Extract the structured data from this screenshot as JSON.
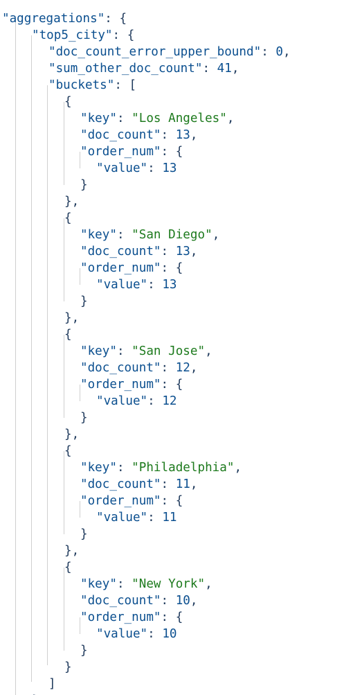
{
  "code_view": {
    "lines": [
      {
        "text": "\"aggregations\": {"
      },
      {
        "text": "\"top5_city\": {"
      },
      {
        "text": "\"doc_count_error_upper_bound\": 0,"
      },
      {
        "text": "\"sum_other_doc_count\": 41,"
      },
      {
        "text": "\"buckets\": ["
      },
      {
        "text": "{"
      },
      {
        "text": "\"key\": \"Los Angeles\","
      },
      {
        "text": "\"doc_count\": 13,"
      },
      {
        "text": "\"order_num\": {"
      },
      {
        "text": "\"value\": 13"
      },
      {
        "text": "}"
      },
      {
        "text": "},"
      },
      {
        "text": "{"
      },
      {
        "text": "\"key\": \"San Diego\","
      },
      {
        "text": "\"doc_count\": 13,"
      },
      {
        "text": "\"order_num\": {"
      },
      {
        "text": "\"value\": 13"
      },
      {
        "text": "}"
      },
      {
        "text": "},"
      },
      {
        "text": "{"
      },
      {
        "text": "\"key\": \"San Jose\","
      },
      {
        "text": "\"doc_count\": 12,"
      },
      {
        "text": "\"order_num\": {"
      },
      {
        "text": "\"value\": 12"
      },
      {
        "text": "}"
      },
      {
        "text": "},"
      },
      {
        "text": "{"
      },
      {
        "text": "\"key\": \"Philadelphia\","
      },
      {
        "text": "\"doc_count\": 11,"
      },
      {
        "text": "\"order_num\": {"
      },
      {
        "text": "\"value\": 11"
      },
      {
        "text": "}"
      },
      {
        "text": "},"
      },
      {
        "text": "{"
      },
      {
        "text": "\"key\": \"New York\","
      },
      {
        "text": "\"doc_count\": 10,"
      },
      {
        "text": "\"order_num\": {"
      },
      {
        "text": "\"value\": 10"
      },
      {
        "text": "}"
      },
      {
        "text": "}"
      },
      {
        "text": "]"
      },
      {
        "text": "}"
      }
    ]
  }
}
